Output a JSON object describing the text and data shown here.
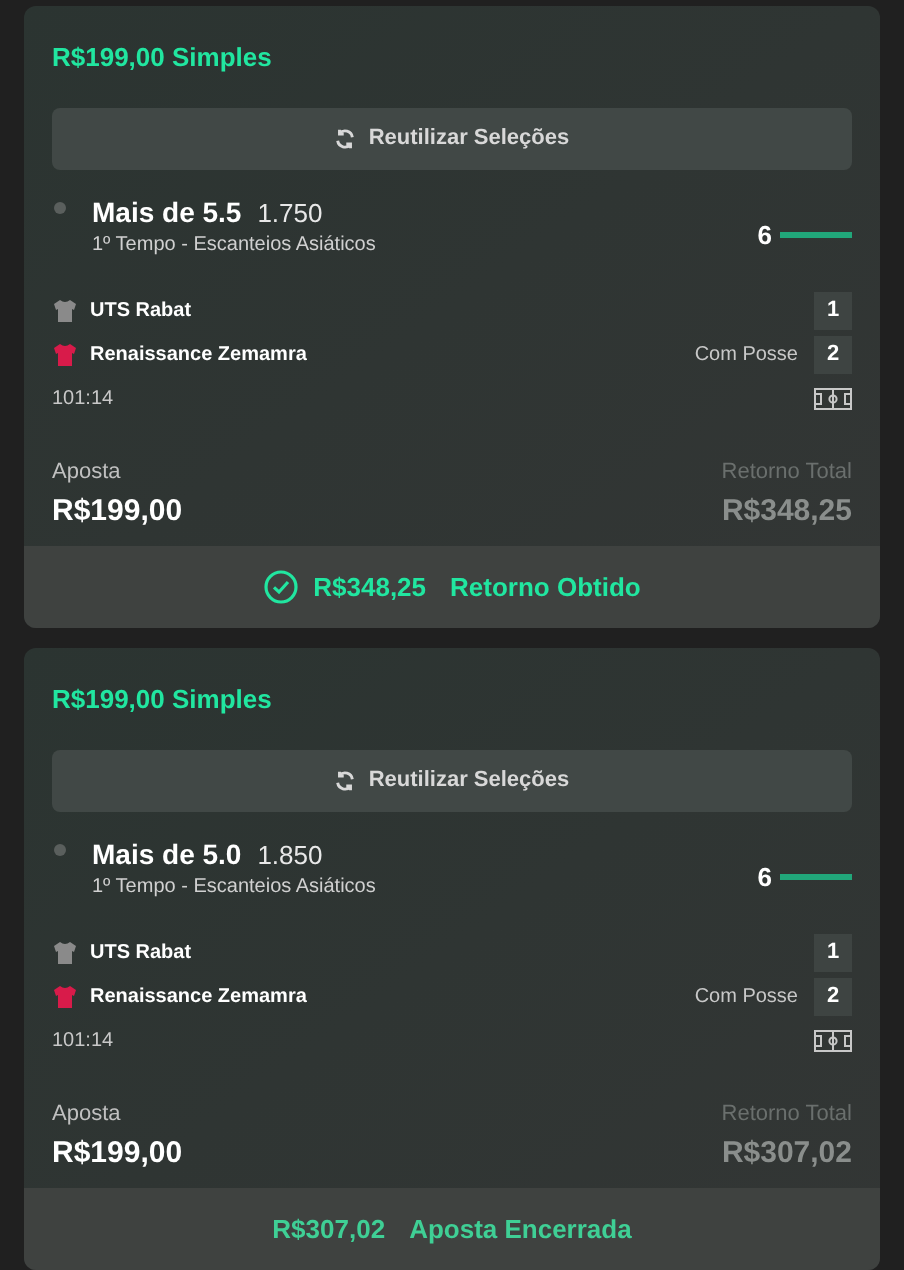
{
  "bets": [
    {
      "title": "R$199,00 Simples",
      "reuse_button": "Reutilizar Seleções",
      "selection": {
        "name": "Mais de 5.5",
        "odds": "1.750",
        "market": "1º Tempo - Escanteios Asiáticos",
        "score": "6"
      },
      "teams": [
        {
          "name": "UTS Rabat",
          "color": "#8a8a8a",
          "score": "1"
        },
        {
          "name": "Renaissance Zemamra",
          "color": "#d81b4a",
          "possession": "Com Posse",
          "score": "2"
        }
      ],
      "time": "101:14",
      "stake_label": "Aposta",
      "stake": "R$199,00",
      "return_label": "Retorno Total",
      "return": "R$348,25",
      "result": {
        "kind": "won",
        "amount": "R$348,25",
        "label": "Retorno Obtido"
      }
    },
    {
      "title": "R$199,00 Simples",
      "reuse_button": "Reutilizar Seleções",
      "selection": {
        "name": "Mais de 5.0",
        "odds": "1.850",
        "market": "1º Tempo - Escanteios Asiáticos",
        "score": "6"
      },
      "teams": [
        {
          "name": "UTS Rabat",
          "color": "#8a8a8a",
          "score": "1"
        },
        {
          "name": "Renaissance Zemamra",
          "color": "#d81b4a",
          "possession": "Com Posse",
          "score": "2"
        }
      ],
      "time": "101:14",
      "stake_label": "Aposta",
      "stake": "R$199,00",
      "return_label": "Retorno Total",
      "return": "R$307,02",
      "result": {
        "kind": "cashed_out",
        "amount": "R$307,02",
        "label": "Aposta Encerrada"
      }
    }
  ]
}
